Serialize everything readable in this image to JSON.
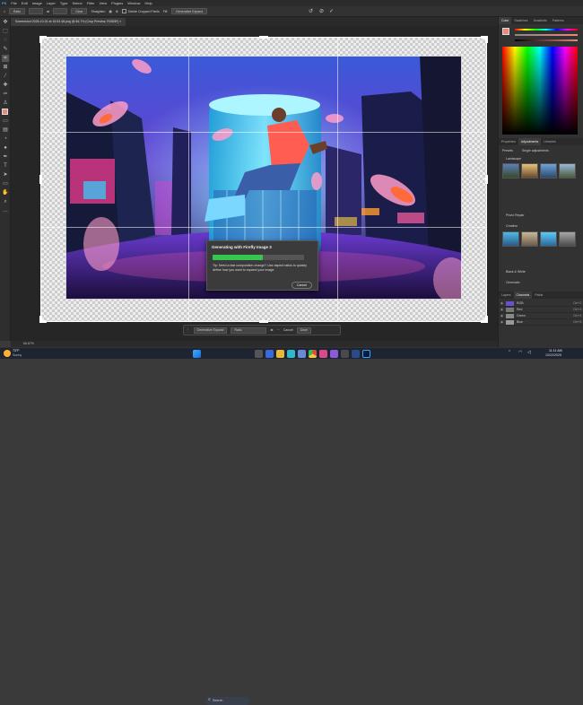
{
  "menu": [
    "PS",
    "File",
    "Edit",
    "Image",
    "Layer",
    "Type",
    "Select",
    "Filter",
    "View",
    "Plugins",
    "Window",
    "Help"
  ],
  "options": {
    "ratio": "Ratio",
    "clear": "Clear",
    "straighten": "Straighten",
    "delete_cropped": "Delete Cropped Pixels",
    "fill": "Generative Expand"
  },
  "document_tab": "Screenshot 2025-10-01 at 15.53.48.png @ 66.7% (Crop Preview, RGB/8*) ×",
  "dialog": {
    "title": "Generating with Firefly Image 3",
    "progress": 0.55,
    "tip": "Tip: Need a fast composition change? Use aspect ratios to quickly define how you want to expand your image.",
    "cancel": "Cancel"
  },
  "context_bar": {
    "generative_expand": "Generative Expand",
    "ratio": "Ratio",
    "cancel": "Cancel",
    "done": "Done"
  },
  "status": "66.67%",
  "panel": {
    "top_tabs": [
      "Color",
      "Swatches",
      "Gradients",
      "Patterns"
    ],
    "mid_tabs": [
      "Properties",
      "Adjustments",
      "Libraries"
    ],
    "presets": "Presets",
    "single": "Single adjustments",
    "sections": [
      "Landscape",
      "Photo Repair",
      "Creative",
      "Black & White",
      "Cinematic"
    ],
    "layer_tabs": [
      "Layers",
      "Channels",
      "Paths"
    ],
    "channels": [
      {
        "name": "RGB",
        "key": "Ctrl+2"
      },
      {
        "name": "Red",
        "key": "Ctrl+3"
      },
      {
        "name": "Green",
        "key": "Ctrl+4"
      },
      {
        "name": "Blue",
        "key": "Ctrl+5"
      }
    ]
  },
  "taskbar": {
    "weather_temp": "73°F",
    "weather_desc": "Sunny",
    "search": "Search",
    "time": "11:11 AM",
    "date": "10/22/2025"
  }
}
